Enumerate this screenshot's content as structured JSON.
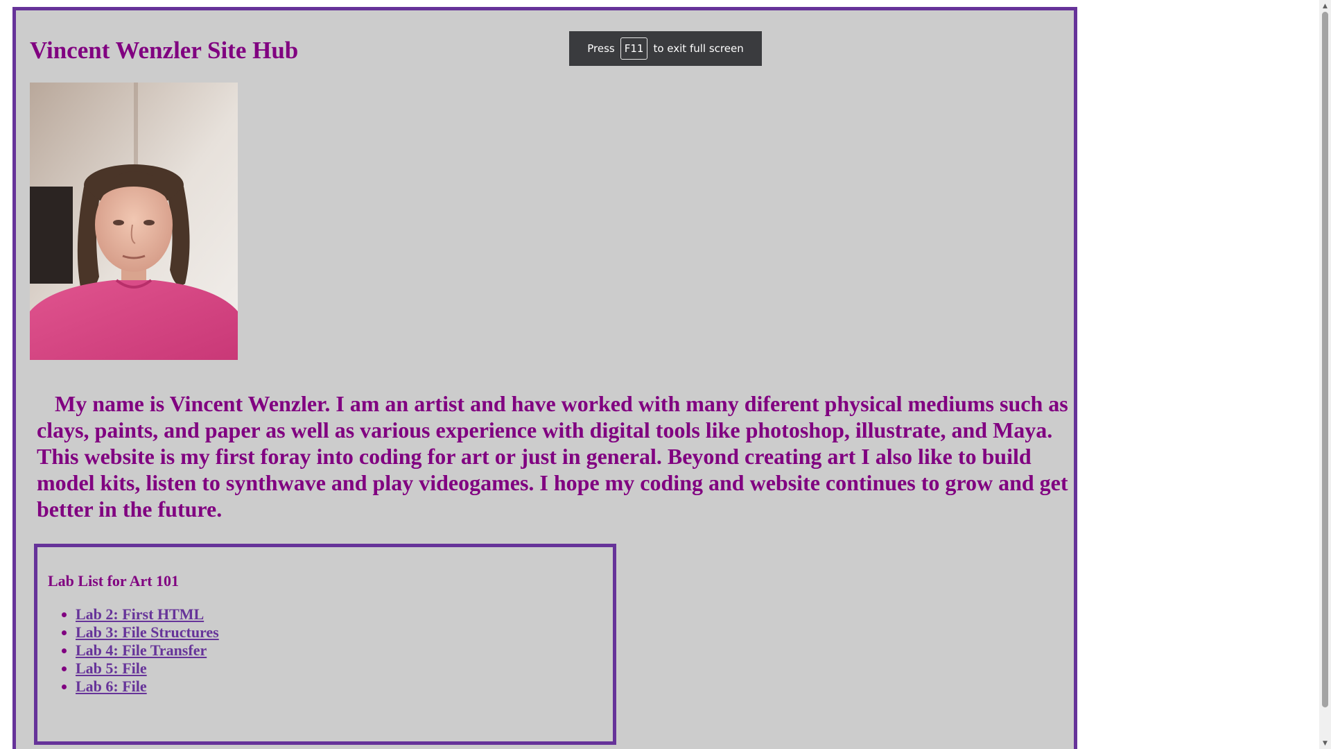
{
  "header": {
    "title": "Vincent Wenzler Site Hub"
  },
  "profile": {
    "photo_alt": "Vincent Wenzler"
  },
  "bio": {
    "text": "My name is Vincent Wenzler. I am an artist and have worked with many diferent physical mediums such as clays, paints, and paper as well as various experience with digital tools like photoshop, illustrate, and Maya. This website is my first foray into coding for art or just in general. Beyond creating art I also like to build model kits, listen to synthwave and play videogames. I hope my coding and website continues to grow and get better in the future."
  },
  "labs": {
    "heading": "Lab List for Art 101",
    "items": [
      {
        "label": "Lab 2: First HTML"
      },
      {
        "label": "Lab 3: File Structures"
      },
      {
        "label": "Lab 4: File Transfer"
      },
      {
        "label": "Lab 5: File"
      },
      {
        "label": "Lab 6: File"
      }
    ]
  },
  "fullscreen_notice": {
    "prefix": "Press",
    "key": "F11",
    "suffix": "to exit full screen"
  },
  "colors": {
    "page_background": "#cccccc",
    "border": "#663399",
    "text": "#800080",
    "link": "#663399",
    "toast_background": "#3a3b3e"
  },
  "icons": {
    "scroll_up": "▲",
    "scroll_down": "▼"
  }
}
